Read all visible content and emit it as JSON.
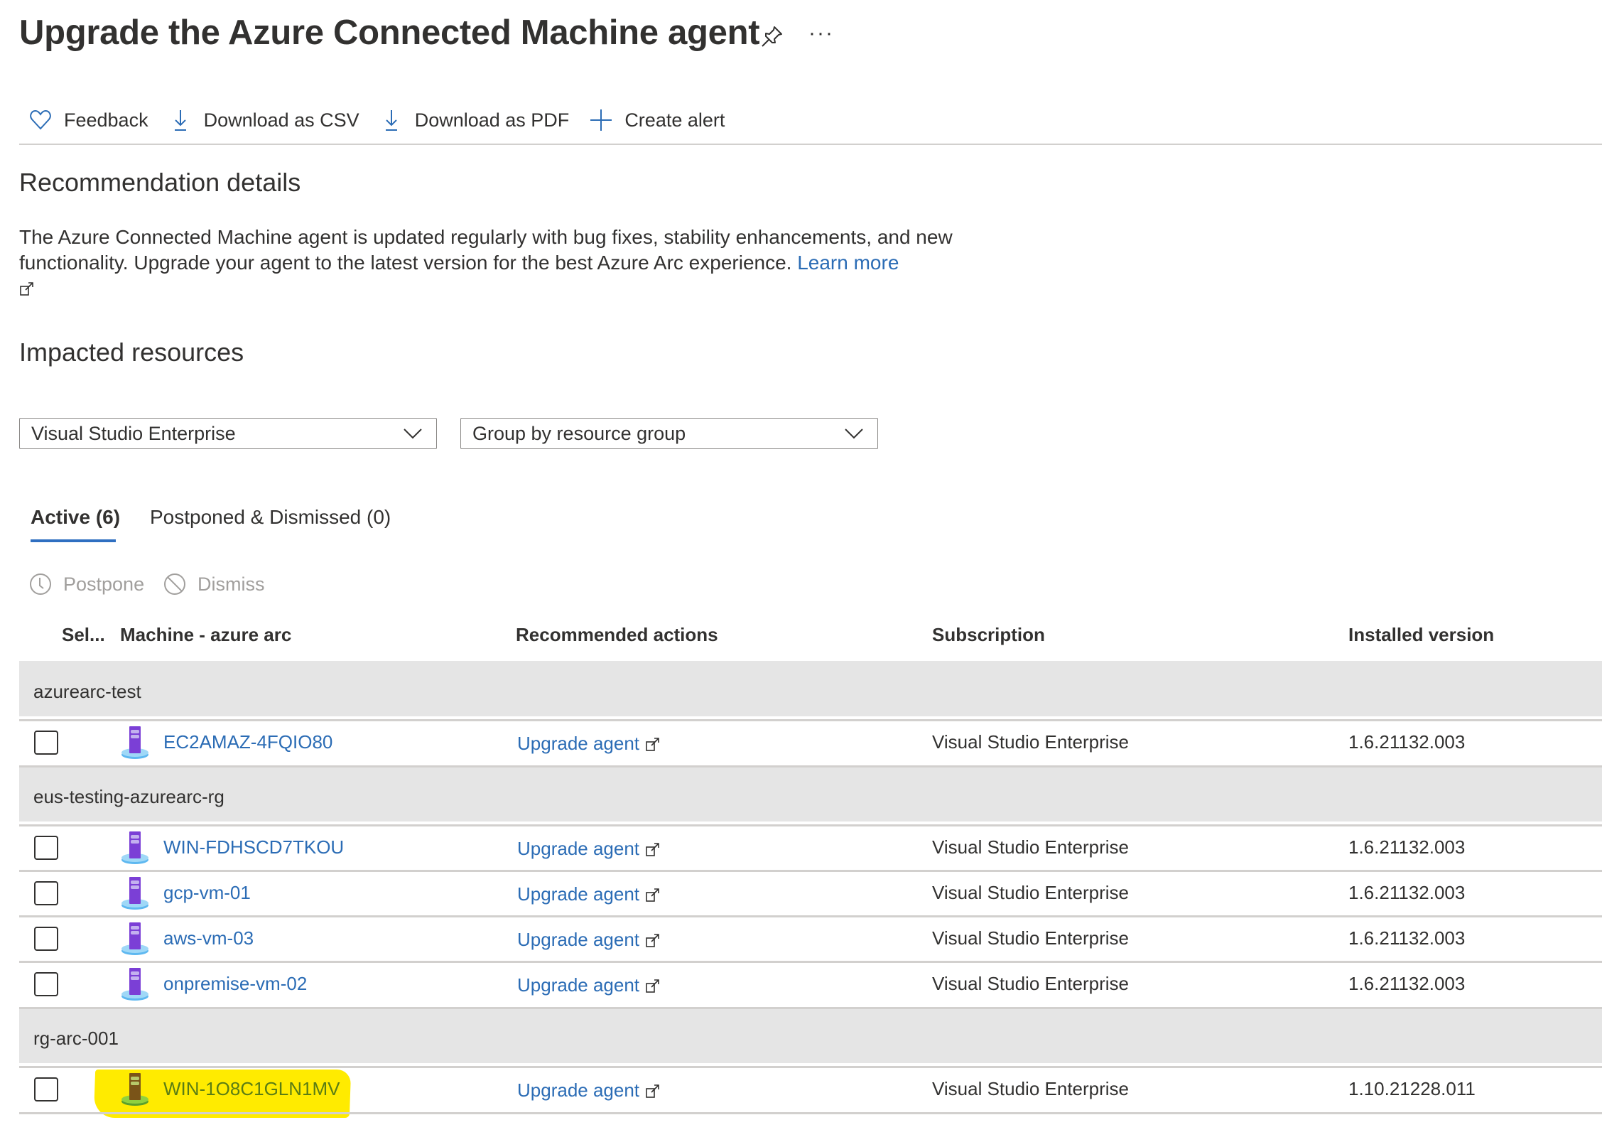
{
  "header": {
    "title": "Upgrade the Azure Connected Machine agent",
    "pin_icon": "pin-icon",
    "more_label": "···"
  },
  "toolbar": {
    "items": [
      {
        "label": "Feedback",
        "icon": "heart-icon"
      },
      {
        "label": "Download as CSV",
        "icon": "download-icon"
      },
      {
        "label": "Download as PDF",
        "icon": "download-icon"
      },
      {
        "label": "Create alert",
        "icon": "plus-icon"
      }
    ]
  },
  "details": {
    "heading": "Recommendation details",
    "text": "The Azure Connected Machine agent is updated regularly with bug fixes, stability enhancements, and new functionality. Upgrade your agent to the latest version for the best Azure Arc experience.",
    "learn_more": "Learn more",
    "learn_more_icon": "external-link-icon"
  },
  "impacted": {
    "heading": "Impacted resources",
    "subscription_filter": "Visual Studio Enterprise",
    "group_by": "Group by resource group"
  },
  "tabs": [
    {
      "label": "Active (6)",
      "active": true
    },
    {
      "label": "Postponed & Dismissed (0)",
      "active": false
    }
  ],
  "commands": [
    {
      "label": "Postpone",
      "icon": "clock-icon",
      "enabled": false
    },
    {
      "label": "Dismiss",
      "icon": "block-icon",
      "enabled": false
    }
  ],
  "table": {
    "columns": [
      "Sel...",
      "Machine - azure arc",
      "Recommended actions",
      "Subscription",
      "Installed version"
    ],
    "groups": [
      {
        "name": "azurearc-test",
        "rows": [
          {
            "machine": "EC2AMAZ-4FQIO80",
            "action": "Upgrade agent",
            "subscription": "Visual Studio Enterprise",
            "version": "1.6.21132.003",
            "checked": false,
            "highlighted": false
          }
        ]
      },
      {
        "name": "eus-testing-azurearc-rg",
        "rows": [
          {
            "machine": "WIN-FDHSCD7TKOU",
            "action": "Upgrade agent",
            "subscription": "Visual Studio Enterprise",
            "version": "1.6.21132.003",
            "checked": false,
            "highlighted": false
          },
          {
            "machine": "gcp-vm-01",
            "action": "Upgrade agent",
            "subscription": "Visual Studio Enterprise",
            "version": "1.6.21132.003",
            "checked": false,
            "highlighted": false
          },
          {
            "machine": "aws-vm-03",
            "action": "Upgrade agent",
            "subscription": "Visual Studio Enterprise",
            "version": "1.6.21132.003",
            "checked": false,
            "highlighted": false
          },
          {
            "machine": "onpremise-vm-02",
            "action": "Upgrade agent",
            "subscription": "Visual Studio Enterprise",
            "version": "1.6.21132.003",
            "checked": false,
            "highlighted": false
          }
        ]
      },
      {
        "name": "rg-arc-001",
        "rows": [
          {
            "machine": "WIN-1O8C1GLN1MV",
            "action": "Upgrade agent",
            "subscription": "Visual Studio Enterprise",
            "version": "1.10.21228.011",
            "checked": false,
            "highlighted": true
          }
        ]
      }
    ]
  },
  "colors": {
    "link": "#2b6cb5",
    "accent": "#2f6fc1",
    "group_bg": "#e5e5e5",
    "highlight": "#ffeb00",
    "vm_icon": "#7b3fd6",
    "vm_icon_base": "#5eb8f0"
  }
}
